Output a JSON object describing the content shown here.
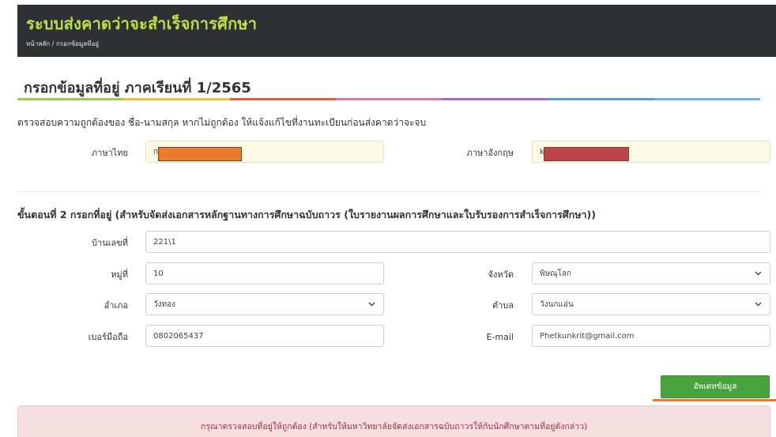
{
  "header": {
    "app_title": "ระบบส่งคาดว่าจะสำเร็จการศึกษา",
    "breadcrumb": "หน้าหลัก / กรอกข้อมูลที่อยู่"
  },
  "page": {
    "title": "กรอกข้อมูลที่อยู่ ภาคเรียนที่ 1/2565"
  },
  "name_check": {
    "notice": "ตรวจสอบความถูกต้องของ ชื่อ-นามสกุล หากไม่ถูกต้อง ให้แจ้งแก้ไขที่งานทะเบียนก่อนส่งคาดว่าจะจบ",
    "thai_label": "ภาษาไทย",
    "thai_value": "ก",
    "english_label": "ภาษาอังกฤษ",
    "english_value": "k"
  },
  "step2": {
    "title": "ขั้นตอนที่ 2 กรอกที่อยู่ (สำหรับจัดส่งเอกสารหลักฐานทางการศึกษาฉบับถาวร (ใบรายงานผลการศึกษาและใบรับรองการสำเร็จการศึกษา))"
  },
  "form": {
    "house_no_label": "บ้านเลขที่",
    "house_no_value": "221\\1",
    "moo_label": "หมู่ที่",
    "moo_value": "10",
    "province_label": "จังหวัด",
    "province_value": "พิษณุโลก",
    "district_label": "อำเภอ",
    "district_value": "วังทอง",
    "subdistrict_label": "ตำบล",
    "subdistrict_value": "วังนกแอ่น",
    "phone_label": "เบอร์มือถือ",
    "phone_value": "0802065437",
    "email_label": "E-mail",
    "email_value": "Phetkunkrit@gmail.com"
  },
  "actions": {
    "update_label": "อัพเดทข้อมูล"
  },
  "alert": {
    "message": "กรุณาตรวจสอบที่อยู่ให้ถูกต้อง (สำหรับให้มหาวิทยาลัยจัดส่งเอกสารฉบับถาวรให้กับนักศึกษาตามที่อยู่ดังกล่าว)"
  },
  "colors": {
    "header_bg": "#2f3033",
    "title_green": "#b9e14a",
    "button_green": "#48a33c",
    "alert_bg": "#f7dfe1",
    "alert_text": "#9b2f3a",
    "redact_orange": "#ee7a2d",
    "redact_red": "#c0454a",
    "rainbow": [
      "#9dcc47",
      "#f2c231",
      "#e85d3c",
      "#d87aa3",
      "#9b6ec9",
      "#5aa0d8",
      "#6ab5e6"
    ]
  },
  "icons": {
    "select_chevron": "chevron-down-icon"
  }
}
